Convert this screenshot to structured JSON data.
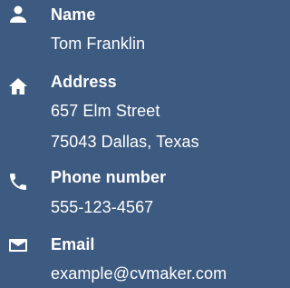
{
  "colors": {
    "background": "#3d5a80",
    "text": "#ffffff"
  },
  "contact": {
    "name": {
      "icon": "person-icon",
      "label": "Name",
      "value": "Tom Franklin"
    },
    "address": {
      "icon": "home-icon",
      "label": "Address",
      "line1": "657 Elm Street",
      "line2": "75043 Dallas, Texas"
    },
    "phone": {
      "icon": "phone-icon",
      "label": "Phone number",
      "value": "555-123-4567"
    },
    "email": {
      "icon": "mail-icon",
      "label": "Email",
      "value": "example@cvmaker.com"
    }
  }
}
